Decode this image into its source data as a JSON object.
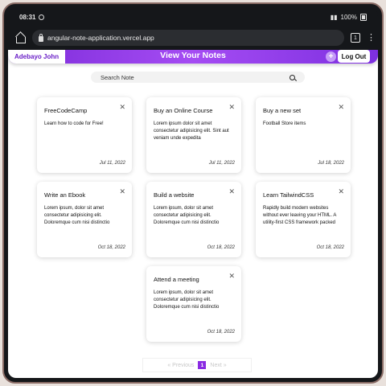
{
  "status": {
    "time": "08:31",
    "battery": "100%"
  },
  "browser": {
    "url": "angular-note-application.vercel.app",
    "tab_count": "1"
  },
  "app": {
    "username": "Adebayo John",
    "title": "View Your Notes",
    "add_label": "+",
    "logout_label": "Log Out",
    "search_placeholder": "Search Note",
    "accent": "#8a2be2"
  },
  "notes": [
    {
      "title": "FreeCodeCamp",
      "body": "Learn how to code for Free!",
      "date": "Jul 11, 2022"
    },
    {
      "title": "Buy an Online Course",
      "body": "Lorem ipsum dolor sit amet consectetur adipisicing elit. Sint aut veniam unde expedita",
      "date": "Jul 11, 2022"
    },
    {
      "title": "Buy a new set",
      "body": "Football Store items",
      "date": "Jul 18, 2022"
    },
    {
      "title": "Write an Ebook",
      "body": "Lorem ipsum, dolor sit amet consectetur adipisicing elit. Doloremque cum nisi distinctio",
      "date": "Oct 18, 2022"
    },
    {
      "title": "Build a website",
      "body": "Lorem ipsum, dolor sit amet consectetur adipisicing elit. Doloremque cum nisi distinctio",
      "date": "Oct 18, 2022"
    },
    {
      "title": "Learn TailwindCSS",
      "body": "Rapidly build modern websites without ever leaving your HTML. A utility-first CSS framework packed",
      "date": "Oct 18, 2022"
    },
    {
      "title": "Attend a meeting",
      "body": "Lorem ipsum, dolor sit amet consectetur adipisicing elit. Doloremque cum nisi distinctio",
      "date": "Oct 18, 2022"
    }
  ],
  "pagination": {
    "prev": "«  Previous",
    "current": "1",
    "next": "Next  »"
  }
}
